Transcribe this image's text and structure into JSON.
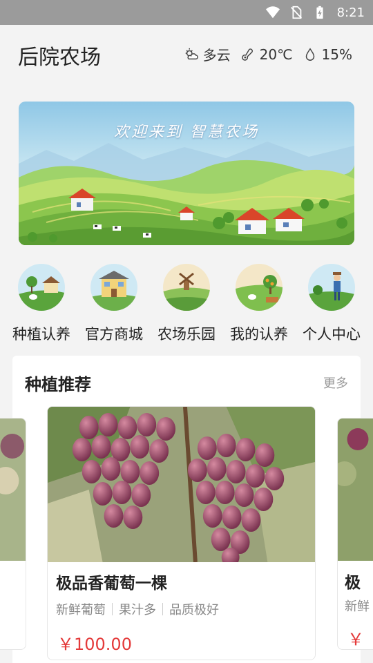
{
  "status_bar": {
    "time": "8:21",
    "icons": [
      "wifi-icon",
      "no-sim-icon",
      "battery-charging-icon"
    ]
  },
  "header": {
    "title": "后院农场",
    "weather": {
      "condition": "多云",
      "temperature": "20℃",
      "humidity": "15%",
      "icons": [
        "partly-cloudy-icon",
        "thermometer-icon",
        "humidity-drop-icon"
      ]
    }
  },
  "banner": {
    "text": "欢迎来到 智慧农场"
  },
  "quick_nav": [
    {
      "label": "种植认养",
      "icon": "planting-adopt-icon"
    },
    {
      "label": "官方商城",
      "icon": "official-mall-icon"
    },
    {
      "label": "农场乐园",
      "icon": "farm-park-icon"
    },
    {
      "label": "我的认养",
      "icon": "my-adopt-icon"
    },
    {
      "label": "个人中心",
      "icon": "personal-center-icon"
    }
  ],
  "recommend": {
    "title": "种植推荐",
    "more": "更多",
    "product": {
      "name": "极品香葡萄一棵",
      "tags": [
        "新鲜葡萄",
        "果汁多",
        "品质极好"
      ],
      "price": "￥100.00"
    },
    "next_product": {
      "name": "极",
      "tag": "新鲜",
      "price": "￥"
    }
  },
  "colors": {
    "price": "#e43a3a",
    "status_bar": "#9b9b9b",
    "background": "#f3f3f3"
  }
}
